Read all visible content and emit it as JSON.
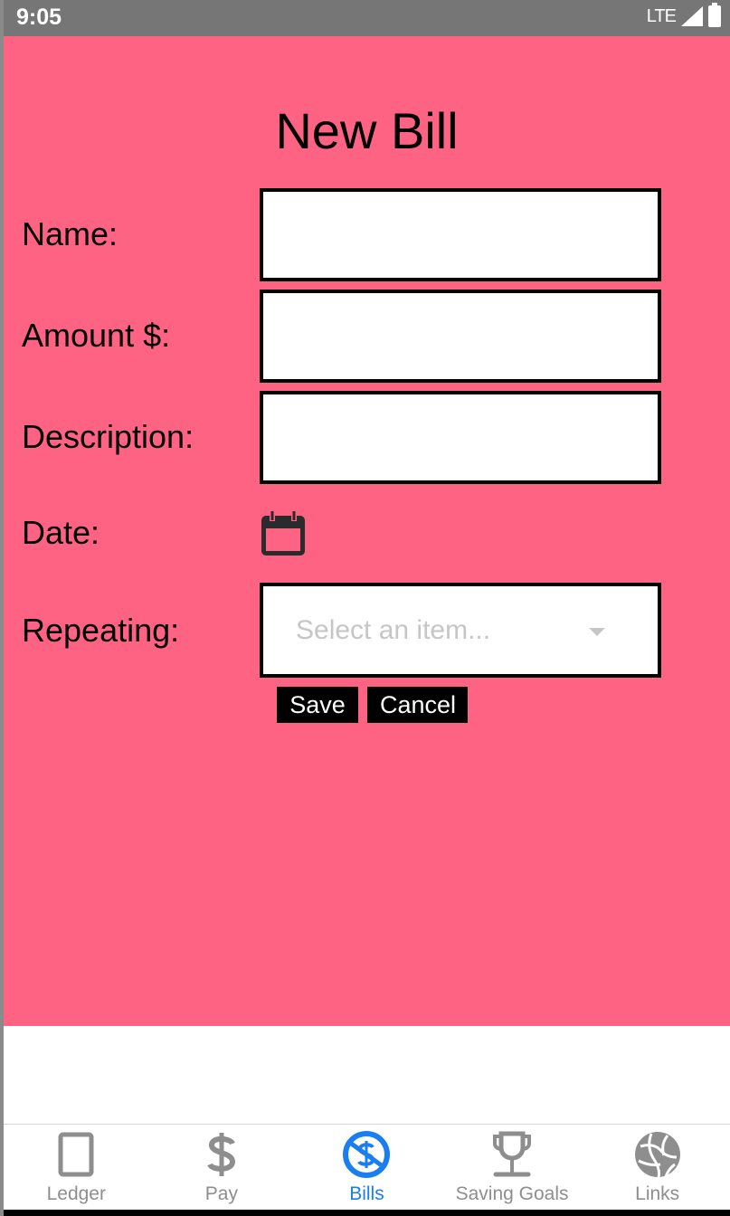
{
  "status_bar": {
    "time": "9:05",
    "network": "LTE",
    "icons": [
      "signal-icon",
      "battery-icon"
    ]
  },
  "colors": {
    "background": "#ff6384",
    "status_bar": "#767676",
    "active_tab": "#1a7ef0",
    "inactive_tab": "#8e8e8e"
  },
  "page": {
    "title": "New Bill"
  },
  "form": {
    "name_label": "Name:",
    "name_value": "",
    "amount_label": "Amount $:",
    "amount_value": "",
    "description_label": "Description:",
    "description_value": "",
    "date_label": "Date:",
    "date_icon": "calendar-icon",
    "repeating_label": "Repeating:",
    "repeating_placeholder": "Select an item...",
    "save_label": "Save",
    "cancel_label": "Cancel"
  },
  "tabs": [
    {
      "label": "Ledger",
      "icon": "tablet-icon",
      "active": false
    },
    {
      "label": "Pay",
      "icon": "dollar-icon",
      "active": false
    },
    {
      "label": "Bills",
      "icon": "no-dollar-icon",
      "active": true
    },
    {
      "label": "Saving Goals",
      "icon": "trophy-icon",
      "active": false
    },
    {
      "label": "Links",
      "icon": "globe-icon",
      "active": false
    }
  ]
}
